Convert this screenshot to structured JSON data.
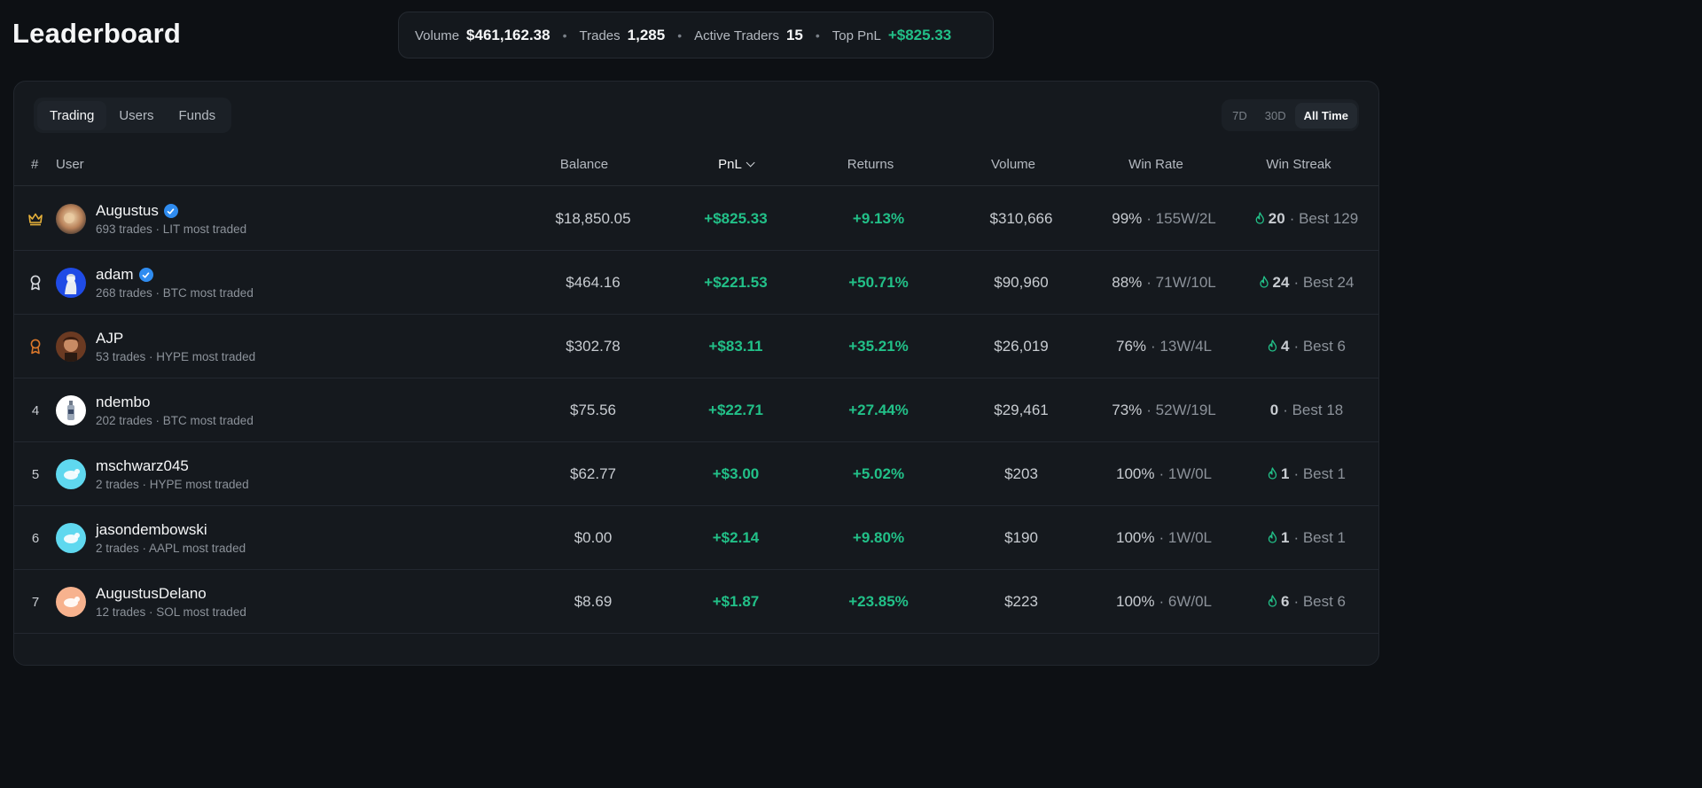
{
  "header": {
    "title": "Leaderboard"
  },
  "stats": [
    {
      "label": "Volume",
      "value": "$461,162.38",
      "accent": false
    },
    {
      "label": "Trades",
      "value": "1,285",
      "accent": false
    },
    {
      "label": "Active Traders",
      "value": "15",
      "accent": false
    },
    {
      "label": "Top PnL",
      "value": "+$825.33",
      "accent": true
    }
  ],
  "tabs": [
    {
      "label": "Trading",
      "active": true
    },
    {
      "label": "Users",
      "active": false
    },
    {
      "label": "Funds",
      "active": false
    }
  ],
  "time_ranges": [
    {
      "label": "7D",
      "active": false
    },
    {
      "label": "30D",
      "active": false
    },
    {
      "label": "All Time",
      "active": true
    }
  ],
  "columns": {
    "rank": "#",
    "user": "User",
    "balance": "Balance",
    "pnl": "PnL",
    "returns": "Returns",
    "volume": "Volume",
    "win_rate": "Win Rate",
    "win_streak": "Win Streak"
  },
  "colors": {
    "positive": "#22c088",
    "gold": "#e8b23a",
    "silver": "#d6d9de",
    "bronze": "#d9772b",
    "verified": "#2f8cf0"
  },
  "rows": [
    {
      "rank": "",
      "rank_icon": "crown-icon",
      "name": "Augustus",
      "verified": true,
      "sub": "693 trades · LIT most traded",
      "balance": "$18,850.05",
      "pnl": "+$825.33",
      "returns": "+9.13%",
      "volume": "$310,666",
      "win_rate": "99%",
      "win_record": "· 155W/2L",
      "streak": "20",
      "best": "· Best 129",
      "flame": true,
      "avatar": "painting"
    },
    {
      "rank": "",
      "rank_icon": "silver-medal-icon",
      "name": "adam",
      "verified": true,
      "sub": "268 trades · BTC most traded",
      "balance": "$464.16",
      "pnl": "+$221.53",
      "returns": "+50.71%",
      "volume": "$90,960",
      "win_rate": "88%",
      "win_record": "· 71W/10L",
      "streak": "24",
      "best": "· Best 24",
      "flame": true,
      "avatar": "statue"
    },
    {
      "rank": "",
      "rank_icon": "bronze-medal-icon",
      "name": "AJP",
      "verified": false,
      "sub": "53 trades · HYPE most traded",
      "balance": "$302.78",
      "pnl": "+$83.11",
      "returns": "+35.21%",
      "volume": "$26,019",
      "win_rate": "76%",
      "win_record": "· 13W/4L",
      "streak": "4",
      "best": "· Best 6",
      "flame": true,
      "avatar": "portrait"
    },
    {
      "rank": "4",
      "rank_icon": "",
      "name": "ndembo",
      "verified": false,
      "sub": "202 trades · BTC most traded",
      "balance": "$75.56",
      "pnl": "+$22.71",
      "returns": "+27.44%",
      "volume": "$29,461",
      "win_rate": "73%",
      "win_record": "· 52W/19L",
      "streak": "0",
      "best": "· Best 18",
      "flame": false,
      "avatar": "bottle"
    },
    {
      "rank": "5",
      "rank_icon": "",
      "name": "mschwarz045",
      "verified": false,
      "sub": "2 trades · HYPE most traded",
      "balance": "$62.77",
      "pnl": "+$3.00",
      "returns": "+5.02%",
      "volume": "$203",
      "win_rate": "100%",
      "win_record": "· 1W/0L",
      "streak": "1",
      "best": "· Best 1",
      "flame": true,
      "avatar": "cyan"
    },
    {
      "rank": "6",
      "rank_icon": "",
      "name": "jasondembowski",
      "verified": false,
      "sub": "2 trades · AAPL most traded",
      "balance": "$0.00",
      "pnl": "+$2.14",
      "returns": "+9.80%",
      "volume": "$190",
      "win_rate": "100%",
      "win_record": "· 1W/0L",
      "streak": "1",
      "best": "· Best 1",
      "flame": true,
      "avatar": "cyan"
    },
    {
      "rank": "7",
      "rank_icon": "",
      "name": "AugustusDelano",
      "verified": false,
      "sub": "12 trades · SOL most traded",
      "balance": "$8.69",
      "pnl": "+$1.87",
      "returns": "+23.85%",
      "volume": "$223",
      "win_rate": "100%",
      "win_record": "· 6W/0L",
      "streak": "6",
      "best": "· Best 6",
      "flame": true,
      "avatar": "peach"
    }
  ]
}
